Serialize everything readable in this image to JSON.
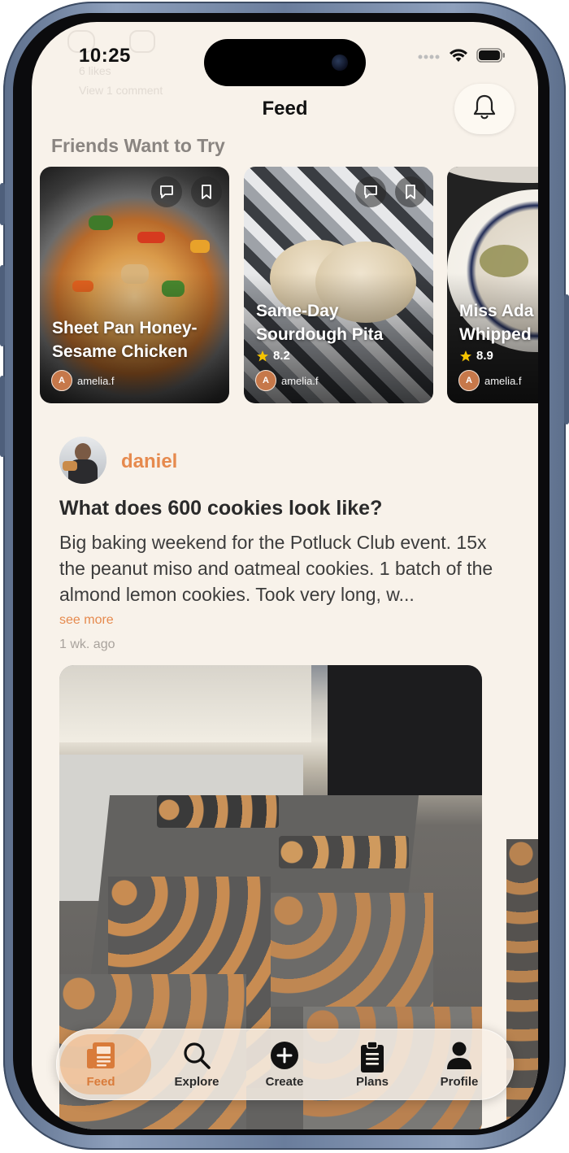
{
  "status_bar": {
    "time": "10:25"
  },
  "header": {
    "title": "Feed",
    "bell_icon": "bell-icon"
  },
  "ghost": {
    "count": "6 likes",
    "comment": "View 1 comment"
  },
  "friends_section": {
    "title": "Friends Want to Try",
    "cards": [
      {
        "title_line1": "Sheet Pan Honey-",
        "title_line2": "Sesame Chicken",
        "rating": "",
        "author_initial": "A",
        "author": "amelia.f"
      },
      {
        "title_line1": "Same-Day",
        "title_line2": "Sourdough Pita",
        "rating": "8.2",
        "author_initial": "A",
        "author": "amelia.f"
      },
      {
        "title_line1": "Miss Ada",
        "title_line2": "Whipped",
        "rating": "8.9",
        "author_initial": "A",
        "author": "amelia.f"
      }
    ]
  },
  "post": {
    "username": "daniel",
    "title": "What does 600 cookies look like?",
    "body": "Big baking weekend for the Potluck Club event. 15x the peanut miso and oatmeal cookies. 1 batch of the almond lemon cookies. Took very long, w...",
    "see_more": "see more",
    "timestamp": "1 wk. ago"
  },
  "tabbar": {
    "tabs": [
      {
        "label": "Feed",
        "icon": "feed-icon",
        "active": true
      },
      {
        "label": "Explore",
        "icon": "search-icon"
      },
      {
        "label": "Create",
        "icon": "plus-circle-icon"
      },
      {
        "label": "Plans",
        "icon": "clipboard-icon"
      },
      {
        "label": "Profile",
        "icon": "person-icon"
      }
    ]
  },
  "colors": {
    "accent": "#e68a4e",
    "background": "#f8f2ea",
    "star": "#f5c400"
  }
}
